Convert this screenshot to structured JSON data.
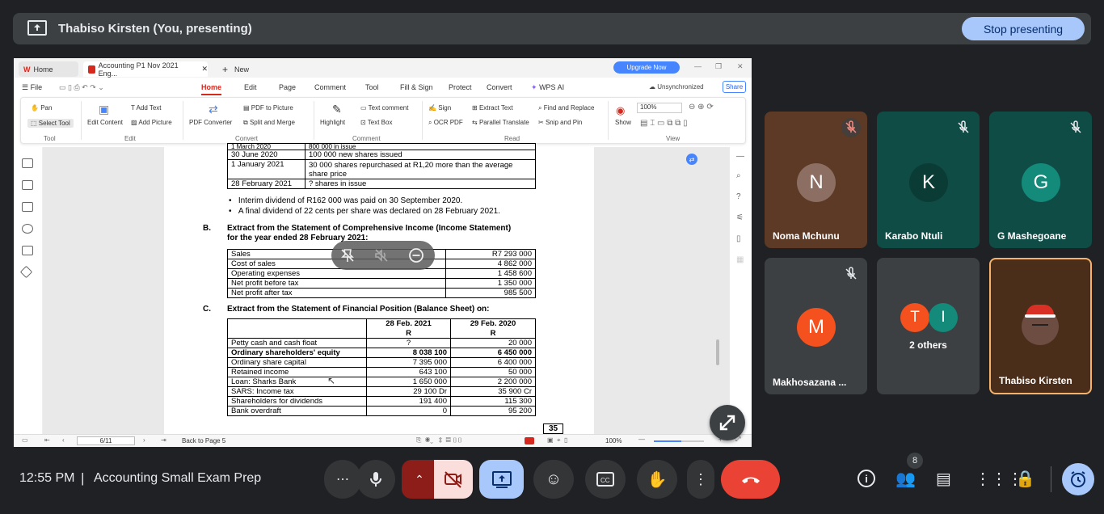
{
  "presenting_bar": {
    "text": "Thabiso Kirsten (You, presenting)",
    "stop_label": "Stop presenting"
  },
  "wps": {
    "tab_home": "Home",
    "tab_doc": "Accounting P1 Nov 2021 Eng...",
    "tab_new": "New",
    "upgrade": "Upgrade Now",
    "file_menu": "File",
    "menus": [
      "Home",
      "Edit",
      "Page",
      "Comment",
      "Tool",
      "Fill & Sign",
      "Protect",
      "Convert",
      "WPS AI"
    ],
    "unsync": "Unsynchronized",
    "share": "Share",
    "ribbon": {
      "pan": "Pan",
      "select_tool": "Select Tool",
      "tool_group": "Tool",
      "edit_content": "Edit Content",
      "add_text": "Add Text",
      "add_picture": "Add Picture",
      "edit_group": "Edit",
      "pdf_converter": "PDF Converter",
      "pdf_to_picture": "PDF to Picture",
      "split_merge": "Split and Merge",
      "convert_group": "Convert",
      "highlight": "Highlight",
      "text_comment": "Text comment",
      "text_box": "Text Box",
      "comment_group": "Comment",
      "sign": "Sign",
      "ocr_pdf": "OCR PDF",
      "extract_text": "Extract Text",
      "parallel_translate": "Parallel Translate",
      "find_replace": "Find and Replace",
      "snip_pin": "Snip and Pin",
      "read_group": "Read",
      "show": "Show",
      "zoom": "100%",
      "view_group": "View"
    },
    "status": {
      "page": "6/11",
      "back": "Back to Page 5",
      "zoom": "100%"
    }
  },
  "doc": {
    "top_table": [
      [
        "1 March 2020",
        "800 000 in issue"
      ],
      [
        "30 June 2020",
        "100 000 new shares issued"
      ],
      [
        "1 January 2021",
        "30 000 shares repurchased at R1,20 more than the average share price"
      ],
      [
        "28 February 2021",
        "? shares in issue"
      ]
    ],
    "bullets": [
      "Interim dividend of R162 000 was paid on 30 September 2020.",
      "A final dividend of 22 cents per share was declared on 28 February 2021."
    ],
    "section_b_letter": "B.",
    "section_b_title1": "Extract from the Statement of Comprehensive Income (Income Statement)",
    "section_b_title2": "for the year ended 28 February 2021:",
    "income_rows": [
      [
        "Sales",
        "R7 293 000"
      ],
      [
        "Cost of sales",
        "4 862 000"
      ],
      [
        "Operating expenses",
        "1 458 600"
      ],
      [
        "Net profit before tax",
        "1 350 000"
      ],
      [
        "Net profit after tax",
        "985 500"
      ]
    ],
    "section_c_letter": "C.",
    "section_c_title": "Extract from the Statement of Financial Position (Balance Sheet) on:",
    "bs_head": [
      "28 Feb. 2021",
      "R",
      "29 Feb. 2020",
      "R"
    ],
    "bs_rows": [
      [
        "Petty cash and cash float",
        "?",
        "20 000"
      ],
      [
        "Ordinary shareholders' equity",
        "8 038 100",
        "6 450 000"
      ],
      [
        "Ordinary share capital",
        "7 395 000",
        "6 400 000"
      ],
      [
        "Retained income",
        "643 100",
        "50 000"
      ],
      [
        "Loan: Sharks Bank",
        "1 650 000",
        "2 200 000"
      ],
      [
        "SARS: Income tax",
        "29 100 Dr",
        "35 900 Cr"
      ],
      [
        "Shareholders for dividends",
        "191 400",
        "115 300"
      ],
      [
        "Bank overdraft",
        "0",
        "95 200"
      ]
    ],
    "page_number": "35"
  },
  "participants": [
    {
      "name": "Noma Mchunu",
      "initial": "N",
      "bg": "#5c3a26",
      "avatar": "#8d6e63"
    },
    {
      "name": "Karabo Ntuli",
      "initial": "K",
      "bg": "#0f4c45",
      "avatar": "#0b3b35"
    },
    {
      "name": "G Mashegoane",
      "initial": "G",
      "bg": "#0f4c45",
      "avatar": "#138a7a"
    },
    {
      "name": "Makhosazana ...",
      "initial": "M",
      "bg": "#3c4043",
      "avatar": "#f4511e"
    },
    {
      "name": "2 others",
      "initials": [
        "T",
        "I"
      ],
      "bg": "#3c4043"
    },
    {
      "name": "Thabiso Kirsten",
      "bg": "#4a2e1a"
    }
  ],
  "bottom": {
    "time": "12:55 PM",
    "separator": "|",
    "meeting": "Accounting Small Exam Prep",
    "people_count": "8"
  },
  "colors": {
    "accent": "#a8c7fa",
    "end_call": "#ea4335",
    "wps_red": "#d7281e"
  }
}
